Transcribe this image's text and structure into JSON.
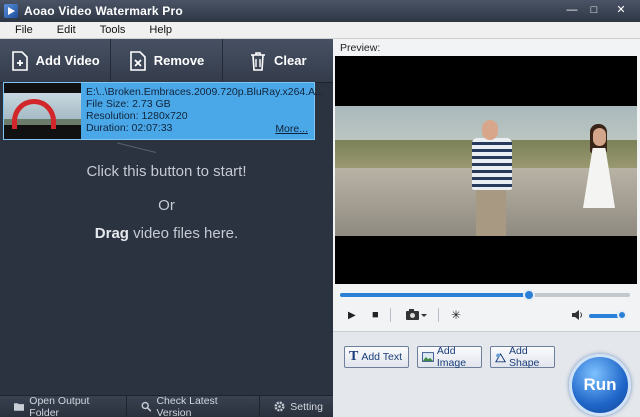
{
  "window": {
    "title": "Aoao Video Watermark Pro"
  },
  "menu": [
    "File",
    "Edit",
    "Tools",
    "Help"
  ],
  "toolbar": {
    "add_video": "Add Video",
    "remove": "Remove",
    "clear": "Clear"
  },
  "file": {
    "path": "E:\\..\\Broken.Embraces.2009.720p.BluRay.x264.A...",
    "size": "File Size: 2.73 GB",
    "resolution": "Resolution: 1280x720",
    "duration": "Duration: 02:07:33",
    "more": "More...",
    "selected": true
  },
  "hint": {
    "line1": "Click this button to start!",
    "line2": "Or",
    "line3_bold": "Drag",
    "line3_rest": " video files here."
  },
  "bottom": {
    "open_folder": "Open Output Folder",
    "check_version": "Check Latest Version",
    "setting": "Setting"
  },
  "preview": {
    "label": "Preview:",
    "seek_progress": 0.65,
    "volume": 1.0
  },
  "actions": {
    "add_text": "Add Text",
    "add_image": "Add Image",
    "add_shape": "Add Shape",
    "run": "Run"
  },
  "colors": {
    "accent": "#2a7fd6",
    "selection": "#4aa8e8",
    "panel": "#2b3240"
  }
}
